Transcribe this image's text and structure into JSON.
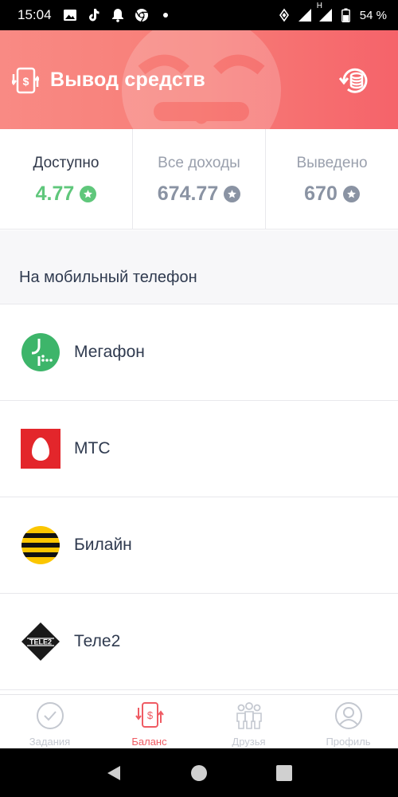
{
  "status_bar": {
    "time": "15:04",
    "battery": "54 %",
    "network": "H",
    "icons": [
      "image-icon",
      "tiktok-icon",
      "bell-icon",
      "chrome-icon",
      "dot-icon",
      "vibrate-icon",
      "signal-icon",
      "battery-icon"
    ]
  },
  "header": {
    "title": "Вывод средств",
    "icon": "withdraw-dollar-icon",
    "action_icon": "history-coins-icon",
    "colors": {
      "start": "#f98a84",
      "end": "#f5636a"
    }
  },
  "stats": [
    {
      "label": "Доступно",
      "value": "4.77",
      "icon": "star-icon",
      "color": "#5fc77b"
    },
    {
      "label": "Все доходы",
      "value": "674.77",
      "icon": "star-icon",
      "color": "#8a93a3"
    },
    {
      "label": "Выведено",
      "value": "670",
      "icon": "star-icon",
      "color": "#8a93a3"
    }
  ],
  "section": {
    "title": "На мобильный телефон"
  },
  "operators": [
    {
      "name": "Мегафон",
      "logo": "megafon-logo",
      "color": "#3db56a"
    },
    {
      "name": "МТС",
      "logo": "mts-logo",
      "color": "#e3262b"
    },
    {
      "name": "Билайн",
      "logo": "beeline-logo",
      "color": "#fbc600"
    },
    {
      "name": "Теле2",
      "logo": "tele2-logo",
      "color": "#1a1a1a"
    }
  ],
  "bottom_nav": [
    {
      "label": "Задания",
      "icon": "check-circle-icon",
      "active": false
    },
    {
      "label": "Баланс",
      "icon": "withdraw-dollar-icon",
      "active": true
    },
    {
      "label": "Друзья",
      "icon": "friends-icon",
      "active": false
    },
    {
      "label": "Профиль",
      "icon": "profile-icon",
      "active": false
    }
  ],
  "colors": {
    "accent": "#ef5b63",
    "positive": "#5fc77b",
    "muted": "#8a93a3",
    "text": "#2f3a4f"
  }
}
